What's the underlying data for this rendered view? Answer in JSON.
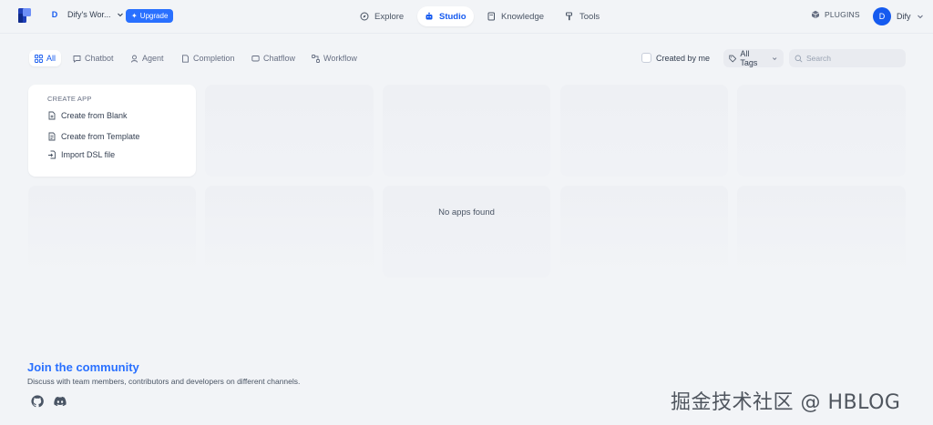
{
  "workspace": {
    "badge": "D",
    "name": "Dify's Wor..."
  },
  "upgrade_label": "Upgrade",
  "nav": {
    "explore": "Explore",
    "studio": "Studio",
    "knowledge": "Knowledge",
    "tools": "Tools"
  },
  "plugins_label": "PLUGINS",
  "user": {
    "initial": "D",
    "name": "Dify"
  },
  "tabs": {
    "all": "All",
    "chatbot": "Chatbot",
    "agent": "Agent",
    "completion": "Completion",
    "chatflow": "Chatflow",
    "workflow": "Workflow"
  },
  "created_by_me": "Created by me",
  "tags_label": "All Tags",
  "search_placeholder": "Search",
  "create_app": {
    "title": "CREATE APP",
    "from_blank": "Create from Blank",
    "from_template": "Create from Template",
    "import_dsl": "Import DSL file"
  },
  "empty_text": "No apps found",
  "community": {
    "title": "Join the community",
    "subtitle": "Discuss with team members, contributors and developers on different channels."
  },
  "watermark": "掘金技术社区 @ HBLOG",
  "colors": {
    "accent": "#155aef",
    "upgrade": "#2970ff",
    "background": "#f2f4f7"
  }
}
